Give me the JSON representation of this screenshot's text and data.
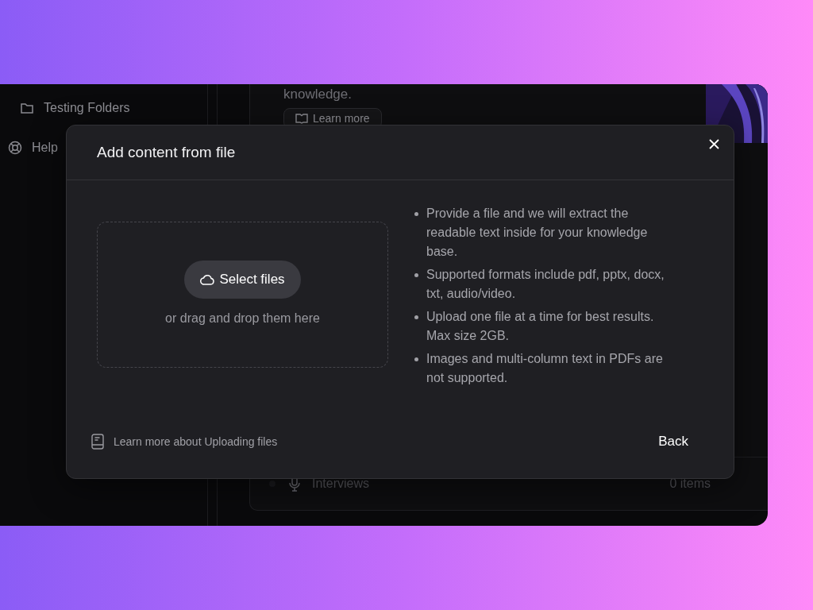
{
  "sidebar": {
    "items": [
      {
        "label": "Testing Folders",
        "kind": "folder"
      },
      {
        "label": "Help",
        "kind": "help"
      }
    ]
  },
  "background_card": {
    "text": "knowledge.",
    "button": "Learn more",
    "rows": [
      {
        "name": "Interviews",
        "count": "0 items"
      }
    ]
  },
  "dialog": {
    "title": "Add content from file",
    "dropzone": {
      "button": "Select files",
      "hint": "or drag and drop them here"
    },
    "notes": [
      "Provide a file and we will extract the readable text inside for your knowledge base.",
      "Supported formats include pdf, pptx, docx, txt, audio/video.",
      "Upload one file at a time for best results. Max size 2GB.",
      "Images and multi-column text in PDFs are not supported."
    ],
    "help_link": "Learn more about Uploading files",
    "back_button": "Back"
  }
}
